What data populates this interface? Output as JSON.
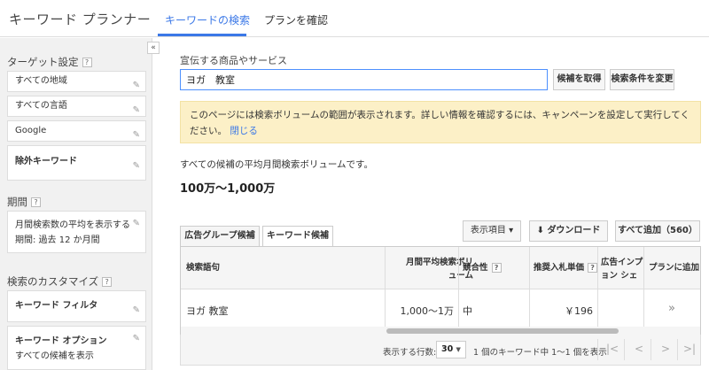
{
  "app": {
    "title": "キーワード プランナー",
    "tabs": [
      {
        "label": "キーワードの検索",
        "active": true
      },
      {
        "label": "プランを確認",
        "active": false
      }
    ],
    "accent_color": "#3b78e7"
  },
  "sidebar": {
    "collapse_icon": "«",
    "targeting": {
      "label": "ターゲット設定",
      "help": "?",
      "items": [
        "すべての地域",
        "すべての言語",
        "Google",
        "除外キーワード"
      ]
    },
    "period": {
      "label": "期間",
      "help": "?",
      "line1": "月間検索数の平均を表示する",
      "line2": "期間: 過去 12 か月間"
    },
    "customize": {
      "label": "検索のカスタマイズ",
      "help": "?",
      "filter_label": "キーワード フィルタ",
      "options_label": "キーワード オプション",
      "options_sub": "すべての候補を表示"
    },
    "pencil_icon": "✎"
  },
  "search": {
    "label": "宣伝する商品やサービス",
    "value": "ヨガ　教室",
    "get_button": "候補を取得",
    "change_button": "検索条件を変更"
  },
  "notice": {
    "text": "このページには検索ボリュームの範囲が表示されます。詳しい情報を確認するには、キャンペーンを設定して実行してください。",
    "link": "閉じる",
    "bg_color": "#fcf0c7"
  },
  "summary": {
    "text": "すべての候補の平均月間検索ボリュームです。",
    "value": "100万〜1,000万"
  },
  "result_tabs": {
    "ad_group": "広告グループ候補",
    "keyword": "キーワード候補",
    "columns_button": "表示項目 ▾",
    "download_button": "ダウンロード",
    "download_icon": "⬇",
    "add_all_button": "すべて追加（560）"
  },
  "table": {
    "headers": {
      "keyword": "検索語句",
      "volume_l1": "月間平均検索ボリ",
      "volume_l2": "ューム",
      "competition": "競合性",
      "bid": "推奨入札単価",
      "impr_l1": "広告インプ",
      "impr_l2": "ョン シェ",
      "add": "プランに追加",
      "help": "?"
    },
    "rows": [
      {
        "keyword": "ヨガ 教室",
        "volume": "1,000〜1万",
        "competition": "中",
        "bid": "￥196",
        "add_icon": "»"
      }
    ]
  },
  "pager": {
    "rows_label": "表示する行数:",
    "rows_value": "30",
    "status": "1 個のキーワード中 1〜1 個を表示",
    "first_icon": "|<",
    "prev_icon": "<",
    "next_icon": ">",
    "last_icon": ">|"
  }
}
